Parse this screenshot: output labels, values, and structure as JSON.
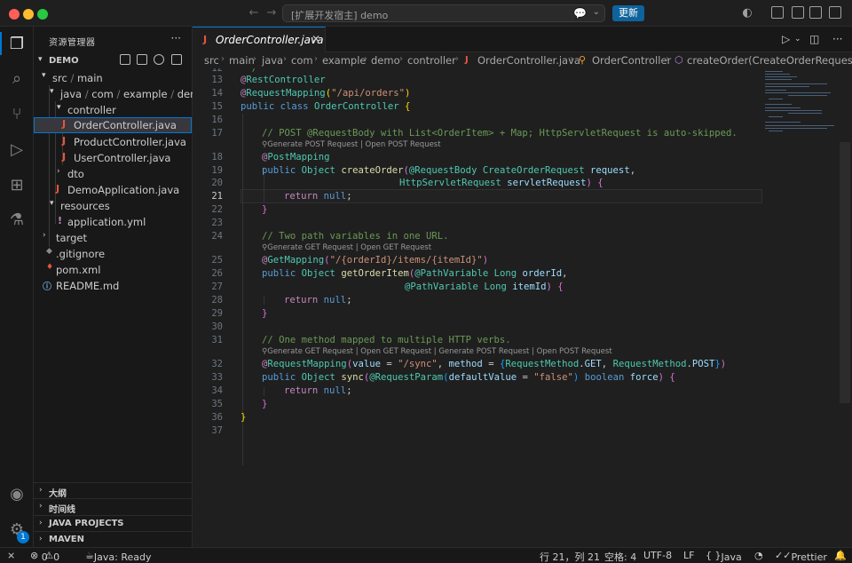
{
  "titlebar": {
    "command_center": "[扩展开发宿主] demo",
    "update_label": "更新"
  },
  "sidebar": {
    "title": "资源管理器",
    "project": "DEMO",
    "tree": [
      {
        "label": "src",
        "label2": "main",
        "depth": 0,
        "arrow": "down"
      },
      {
        "label": "java",
        "label2": "com",
        "label3": "example",
        "label4": "demo",
        "depth": 1,
        "arrow": "down"
      },
      {
        "label": "controller",
        "depth": 2,
        "arrow": "down"
      },
      {
        "label": "OrderController.java",
        "depth": 3,
        "icon": "java",
        "selected": true
      },
      {
        "label": "ProductController.java",
        "depth": 3,
        "icon": "java"
      },
      {
        "label": "UserController.java",
        "depth": 3,
        "icon": "java"
      },
      {
        "label": "dto",
        "depth": 2,
        "arrow": "right"
      },
      {
        "label": "DemoApplication.java",
        "depth": 2,
        "icon": "java"
      },
      {
        "label": "resources",
        "depth": 1,
        "arrow": "down"
      },
      {
        "label": "application.yml",
        "depth": 2,
        "icon": "yml"
      },
      {
        "label": "target",
        "depth": 0,
        "arrow": "right"
      },
      {
        "label": ".gitignore",
        "depth": 0,
        "icon": "git"
      },
      {
        "label": "pom.xml",
        "depth": 0,
        "icon": "xml"
      },
      {
        "label": "README.md",
        "depth": 0,
        "icon": "info"
      }
    ],
    "sections": [
      "大纲",
      "时间线",
      "JAVA PROJECTS",
      "MAVEN"
    ]
  },
  "tab": {
    "label": "OrderController.java"
  },
  "breadcrumb": [
    "src",
    "main",
    "java",
    "com",
    "example",
    "demo",
    "controller",
    "OrderController.java",
    "OrderController",
    "createOrder(CreateOrderRequest, Ht"
  ],
  "editor": {
    "line_numbers": [
      "12",
      "13",
      "14",
      "15",
      "16",
      "17",
      "18",
      "19",
      "20",
      "21",
      "22",
      "23",
      "24",
      "25",
      "26",
      "27",
      "28",
      "29",
      "30",
      "31",
      "32",
      "33",
      "34",
      "35",
      "36",
      "37"
    ],
    "active_line": "21",
    "code": {
      "l12": " */",
      "l13a": "@",
      "l13b": "RestController",
      "l14a": "@",
      "l14b": "RequestMapping",
      "l14c": "(",
      "l14d": "\"/api/orders\"",
      "l14e": ")",
      "l15a": "public",
      "l15b": "class",
      "l15c": "OrderController",
      "l15d": "{",
      "l17": "// POST @RequestBody with List<OrderItem> + Map; HttpServletRequest is auto-skipped.",
      "l18a": "@",
      "l18b": "PostMapping",
      "l19a": "public",
      "l19b": "Object",
      "l19c": "createOrder",
      "l19d": "(",
      "l19e": "@RequestBody",
      "l19f": "CreateOrderRequest",
      "l19g": "request",
      "l20a": "HttpServletRequest",
      "l20b": "servletRequest",
      "l20c": ")",
      "l20d": "{",
      "l21a": "return",
      "l21b": "null",
      "l22": "}",
      "l24": "// Two path variables in one URL.",
      "l25a": "@",
      "l25b": "GetMapping",
      "l25c": "(",
      "l25d": "\"/{orderId}/items/{itemId}\"",
      "l25e": ")",
      "l26a": "public",
      "l26b": "Object",
      "l26c": "getOrderItem",
      "l26d": "(",
      "l26e": "@PathVariable",
      "l26f": "Long",
      "l26g": "orderId",
      "l27a": "@PathVariable",
      "l27b": "Long",
      "l27c": "itemId",
      "l27d": ")",
      "l27e": "{",
      "l28a": "return",
      "l28b": "null",
      "l29": "}",
      "l31": "// One method mapped to multiple HTTP verbs.",
      "l32a": "@",
      "l32b": "RequestMapping",
      "l32c": "(",
      "l32d": "value",
      "l32e": "\"/sync\"",
      "l32f": "method",
      "l32g": "RequestMethod",
      "l32h": "GET",
      "l32i": "RequestMethod",
      "l32j": "POST",
      "l33a": "public",
      "l33b": "Object",
      "l33c": "sync",
      "l33d": "(",
      "l33e": "@RequestParam",
      "l33f": "defaultValue",
      "l33g": "\"false\"",
      "l33h": "boolean",
      "l33i": "force",
      "l33j": ")",
      "l33k": "{",
      "l34a": "return",
      "l34b": "null",
      "l35": "}",
      "l36": "}"
    },
    "lens": {
      "l18": "Generate POST Request | Open POST Request",
      "l25": "Generate GET Request | Open GET Request",
      "l32": "Generate GET Request | Open GET Request | Generate POST Request | Open POST Request"
    }
  },
  "statusbar": {
    "errors": "0",
    "warnings": "0",
    "java": "Java: Ready",
    "position": "行 21，列 21",
    "spaces": "空格: 4",
    "encoding": "UTF-8",
    "eol": "LF",
    "language": "Java",
    "prettier": "Prettier"
  },
  "activity": {
    "badge": "1"
  }
}
